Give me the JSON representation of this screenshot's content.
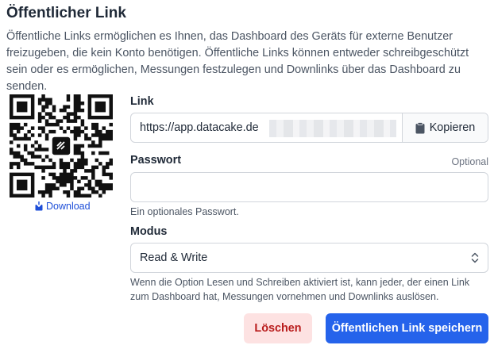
{
  "header": {
    "title": "Öffentlicher Link",
    "description": "Öffentliche Links ermöglichen es Ihnen, das Dashboard des Geräts für externe Benutzer freizugeben, die kein Konto benötigen. Öffentliche Links können entweder schreibgeschützt sein oder es ermöglichen, Messungen festzulegen und Downlinks über das Dashboard zu senden."
  },
  "qr": {
    "download_label": "Download",
    "icon": "download-icon"
  },
  "link": {
    "label": "Link",
    "value": "https://app.datacake.de",
    "copy_label": "Kopieren",
    "copy_icon": "clipboard-icon"
  },
  "password": {
    "label": "Passwort",
    "optional": "Optional",
    "value": "",
    "help": "Ein optionales Passwort."
  },
  "mode": {
    "label": "Modus",
    "selected": "Read & Write",
    "icon": "chevron-up-down-icon",
    "help": "Wenn die Option Lesen und Schreiben aktiviert ist, kann jeder, der einen Link zum Dashboard hat, Messungen vornehmen und Downlinks auslösen."
  },
  "actions": {
    "delete_label": "Löschen",
    "save_label": "Öffentlichen Link speichern"
  },
  "colors": {
    "primary": "#2563eb",
    "danger_bg": "#fde2e2",
    "danger_text": "#b91c1c",
    "link": "#1d4ed8"
  }
}
